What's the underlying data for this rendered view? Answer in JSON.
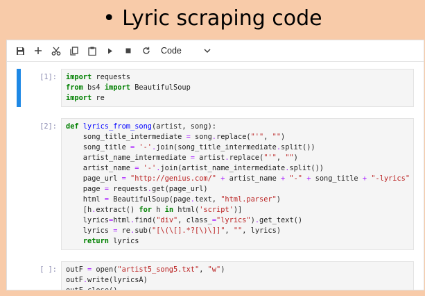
{
  "slide": {
    "bullet": "•",
    "title": "Lyric scraping code"
  },
  "toolbar": {
    "icons": [
      "save-icon",
      "add-cell-icon",
      "cut-icon",
      "copy-icon",
      "paste-icon",
      "run-icon",
      "stop-icon",
      "restart-icon"
    ],
    "cell_type": "Code"
  },
  "cells": [
    {
      "prompt": "[1]:",
      "active": true,
      "lines": [
        [
          [
            "kw",
            "import"
          ],
          [
            "t",
            " requests"
          ]
        ],
        [
          [
            "kw",
            "from"
          ],
          [
            "t",
            " bs4 "
          ],
          [
            "kw",
            "import"
          ],
          [
            "t",
            " BeautifulSoup"
          ]
        ],
        [
          [
            "kw",
            "import"
          ],
          [
            "t",
            " re"
          ]
        ]
      ]
    },
    {
      "prompt": "[2]:",
      "active": false,
      "lines": [
        [
          [
            "kw",
            "def"
          ],
          [
            "t",
            " "
          ],
          [
            "fn",
            "lyrics_from_song"
          ],
          [
            "t",
            "(artist, song):"
          ]
        ],
        [
          [
            "t",
            "    song_title_intermediate "
          ],
          [
            "op",
            "="
          ],
          [
            "t",
            " song"
          ],
          [
            "op",
            "."
          ],
          [
            "t",
            "replace("
          ],
          [
            "str",
            "\"'\""
          ],
          [
            "t",
            ", "
          ],
          [
            "str",
            "\"\""
          ],
          [
            "t",
            ")"
          ]
        ],
        [
          [
            "t",
            "    song_title "
          ],
          [
            "op",
            "="
          ],
          [
            "t",
            " "
          ],
          [
            "str",
            "'-'"
          ],
          [
            "op",
            "."
          ],
          [
            "t",
            "join(song_title_intermediate"
          ],
          [
            "op",
            "."
          ],
          [
            "t",
            "split())"
          ]
        ],
        [
          [
            "t",
            "    artist_name_intermediate "
          ],
          [
            "op",
            "="
          ],
          [
            "t",
            " artist"
          ],
          [
            "op",
            "."
          ],
          [
            "t",
            "replace("
          ],
          [
            "str",
            "\"'\""
          ],
          [
            "t",
            ", "
          ],
          [
            "str",
            "\"\""
          ],
          [
            "t",
            ")"
          ]
        ],
        [
          [
            "t",
            "    artist_name "
          ],
          [
            "op",
            "="
          ],
          [
            "t",
            " "
          ],
          [
            "str",
            "'-'"
          ],
          [
            "op",
            "."
          ],
          [
            "t",
            "join(artist_name_intermediate"
          ],
          [
            "op",
            "."
          ],
          [
            "t",
            "split())"
          ]
        ],
        [
          [
            "t",
            "    page_url "
          ],
          [
            "op",
            "="
          ],
          [
            "t",
            " "
          ],
          [
            "str",
            "\"http://genius.com/\""
          ],
          [
            "t",
            " "
          ],
          [
            "op",
            "+"
          ],
          [
            "t",
            " artist_name "
          ],
          [
            "op",
            "+"
          ],
          [
            "t",
            " "
          ],
          [
            "str",
            "\"-\""
          ],
          [
            "t",
            " "
          ],
          [
            "op",
            "+"
          ],
          [
            "t",
            " song_title "
          ],
          [
            "op",
            "+"
          ],
          [
            "t",
            " "
          ],
          [
            "str",
            "\"-lyrics\""
          ]
        ],
        [
          [
            "t",
            "    page "
          ],
          [
            "op",
            "="
          ],
          [
            "t",
            " requests"
          ],
          [
            "op",
            "."
          ],
          [
            "t",
            "get(page_url)"
          ]
        ],
        [
          [
            "t",
            "    html "
          ],
          [
            "op",
            "="
          ],
          [
            "t",
            " BeautifulSoup(page"
          ],
          [
            "op",
            "."
          ],
          [
            "t",
            "text, "
          ],
          [
            "str",
            "\"html.parser\""
          ],
          [
            "t",
            ")"
          ]
        ],
        [
          [
            "t",
            "    [h"
          ],
          [
            "op",
            "."
          ],
          [
            "t",
            "extract() "
          ],
          [
            "kw",
            "for"
          ],
          [
            "t",
            " h "
          ],
          [
            "kw",
            "in"
          ],
          [
            "t",
            " html("
          ],
          [
            "str",
            "'script'"
          ],
          [
            "t",
            ")]"
          ]
        ],
        [
          [
            "t",
            "    lyrics"
          ],
          [
            "op",
            "="
          ],
          [
            "t",
            "html"
          ],
          [
            "op",
            "."
          ],
          [
            "t",
            "find("
          ],
          [
            "str",
            "\"div\""
          ],
          [
            "t",
            ", class_"
          ],
          [
            "op",
            "="
          ],
          [
            "str",
            "\"lyrics\""
          ],
          [
            "t",
            ")"
          ],
          [
            "op",
            "."
          ],
          [
            "t",
            "get_text()"
          ]
        ],
        [
          [
            "t",
            "    lyrics "
          ],
          [
            "op",
            "="
          ],
          [
            "t",
            " re"
          ],
          [
            "op",
            "."
          ],
          [
            "t",
            "sub("
          ],
          [
            "str",
            "\"[\\(\\[].*?[\\)\\]]\""
          ],
          [
            "t",
            ", "
          ],
          [
            "str",
            "\"\""
          ],
          [
            "t",
            ", lyrics)"
          ]
        ],
        [
          [
            "t",
            "    "
          ],
          [
            "kw",
            "return"
          ],
          [
            "t",
            " lyrics"
          ]
        ]
      ]
    },
    {
      "prompt": "[ ]:",
      "active": false,
      "lines": [
        [
          [
            "t",
            "outF "
          ],
          [
            "op",
            "="
          ],
          [
            "t",
            " open("
          ],
          [
            "str",
            "\"artist5_song5.txt\""
          ],
          [
            "t",
            ", "
          ],
          [
            "str",
            "\"w\""
          ],
          [
            "t",
            ")"
          ]
        ],
        [
          [
            "t",
            "outF"
          ],
          [
            "op",
            "."
          ],
          [
            "t",
            "write(lyricsA)"
          ]
        ],
        [
          [
            "t",
            "outF"
          ],
          [
            "op",
            "."
          ],
          [
            "t",
            "close()"
          ]
        ]
      ]
    }
  ]
}
